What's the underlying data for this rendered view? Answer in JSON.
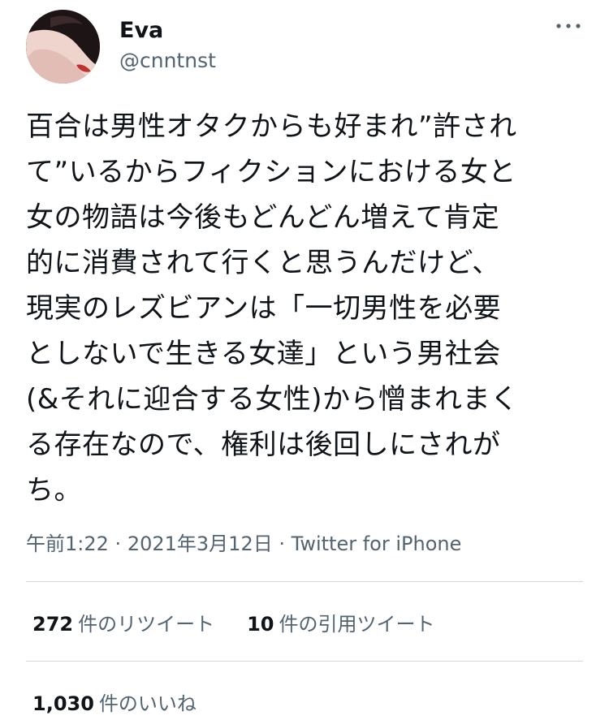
{
  "user": {
    "display_name": "Eva",
    "handle": "@cnntnst"
  },
  "tweet": {
    "text_lines": [
      "百合は男性オタクからも好まれ”許され",
      "て”いるからフィクションにおける女と",
      "女の物語は今後もどんどん増えて肯定",
      "的に消費されて行くと思うんだけど、",
      "現実のレズビアンは「一切男性を必要",
      "としないで生きる女達」という男社会",
      "(&それに迎合する女性)から憎まれまく",
      "る存在なので、権利は後回しにされが",
      "ち。"
    ],
    "time": "午前1:22",
    "date": "2021年3月12日",
    "separator": "·",
    "source": "Twitter for iPhone"
  },
  "stats": {
    "retweets": {
      "count": "272",
      "label": "件のリツイート"
    },
    "quotes": {
      "count": "10",
      "label": "件の引用ツイート"
    },
    "likes": {
      "count": "1,030",
      "label": "件のいいね"
    }
  },
  "icons": {
    "more": "more-dots-icon"
  },
  "colors": {
    "text": "#0f1419",
    "secondary": "#536471",
    "divider": "#cfd9de"
  }
}
